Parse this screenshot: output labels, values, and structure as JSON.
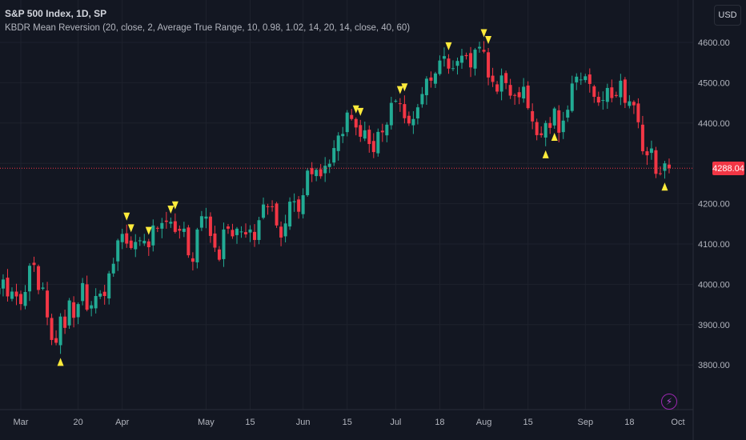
{
  "header": {
    "symbol_title": "S&P 500 Index, 1D, SP",
    "indicator_title": "KBDR Mean Reversion (20, close, 2, Average True Range, 10, 0.98, 1.02, 14, 20, 14, close, 40, 60)"
  },
  "currency_button": "USD",
  "last_price_label": "4288.04",
  "icons": {
    "replay": "lightning-icon"
  },
  "colors": {
    "background": "#131722",
    "up": "#22ab94",
    "down": "#f23645",
    "signal": "#ffeb3b",
    "grid": "#1e222d"
  },
  "chart_data": {
    "type": "candlestick",
    "title": "S&P 500 Index, 1D, SP",
    "ylim": [
      3740,
      4660
    ],
    "y_ticks": [
      "4600.00",
      "4500.00",
      "4400.00",
      "4300.00",
      "4200.00",
      "4100.00",
      "4000.00",
      "3900.00",
      "3800.00"
    ],
    "y_tick_values": [
      4600,
      4500,
      4400,
      4300,
      4200,
      4100,
      4000,
      3900,
      3800
    ],
    "x_ticks": [
      {
        "label": "Mar",
        "index": 0
      },
      {
        "label": "20",
        "index": 13
      },
      {
        "label": "Apr",
        "index": 23
      },
      {
        "label": "May",
        "index": 42
      },
      {
        "label": "15",
        "index": 52
      },
      {
        "label": "Jun",
        "index": 64
      },
      {
        "label": "15",
        "index": 74
      },
      {
        "label": "Jul",
        "index": 85
      },
      {
        "label": "18",
        "index": 95
      },
      {
        "label": "Aug",
        "index": 105
      },
      {
        "label": "15",
        "index": 115
      },
      {
        "label": "Sep",
        "index": 128
      },
      {
        "label": "18",
        "index": 138
      },
      {
        "label": "Oct",
        "index": 149
      }
    ],
    "first_index": -5,
    "closes": [
      3991,
      4012,
      3970,
      3982,
      3970,
      3951,
      3981,
      4046,
      4048,
      3986,
      3992,
      3918,
      3862,
      3855,
      3920,
      3892,
      3960,
      3917,
      3951,
      4003,
      3937,
      3948,
      3971,
      3977,
      3971,
      4027,
      4051,
      4109,
      4125,
      4101,
      4090,
      4105,
      4109,
      4108,
      4092,
      4146,
      4138,
      4152,
      4155,
      4155,
      4130,
      4133,
      4138,
      4072,
      4056,
      4136,
      4169,
      4168,
      4120,
      4091,
      4061,
      4136,
      4138,
      4119,
      4138,
      4131,
      4124,
      4136,
      4110,
      4159,
      4198,
      4192,
      4193,
      4146,
      4116,
      4151,
      4205,
      4206,
      4180,
      4221,
      4282,
      4273,
      4284,
      4268,
      4294,
      4299,
      4338,
      4369,
      4373,
      4426,
      4410,
      4389,
      4366,
      4382,
      4348,
      4328,
      4378,
      4377,
      4396,
      4450,
      4455,
      4447,
      4412,
      4399,
      4410,
      4439,
      4472,
      4510,
      4505,
      4523,
      4555,
      4566,
      4535,
      4536,
      4554,
      4567,
      4566,
      4538,
      4582,
      4589,
      4577,
      4513,
      4502,
      4478,
      4518,
      4499,
      4468,
      4469,
      4464,
      4490,
      4437,
      4404,
      4370,
      4370,
      4400,
      4388,
      4436,
      4376,
      4406,
      4433,
      4498,
      4515,
      4508,
      4516,
      4497,
      4465,
      4451,
      4457,
      4487,
      4462,
      4467,
      4505,
      4450,
      4454,
      4444,
      4402,
      4330,
      4320,
      4337,
      4274,
      4274,
      4300,
      4288.04
    ],
    "sell_signals": [
      24,
      25,
      29,
      34,
      35,
      76,
      77,
      86,
      87,
      97,
      105,
      106
    ],
    "buy_signals": [
      9,
      119,
      121,
      146
    ],
    "last_price": 4288.04
  }
}
